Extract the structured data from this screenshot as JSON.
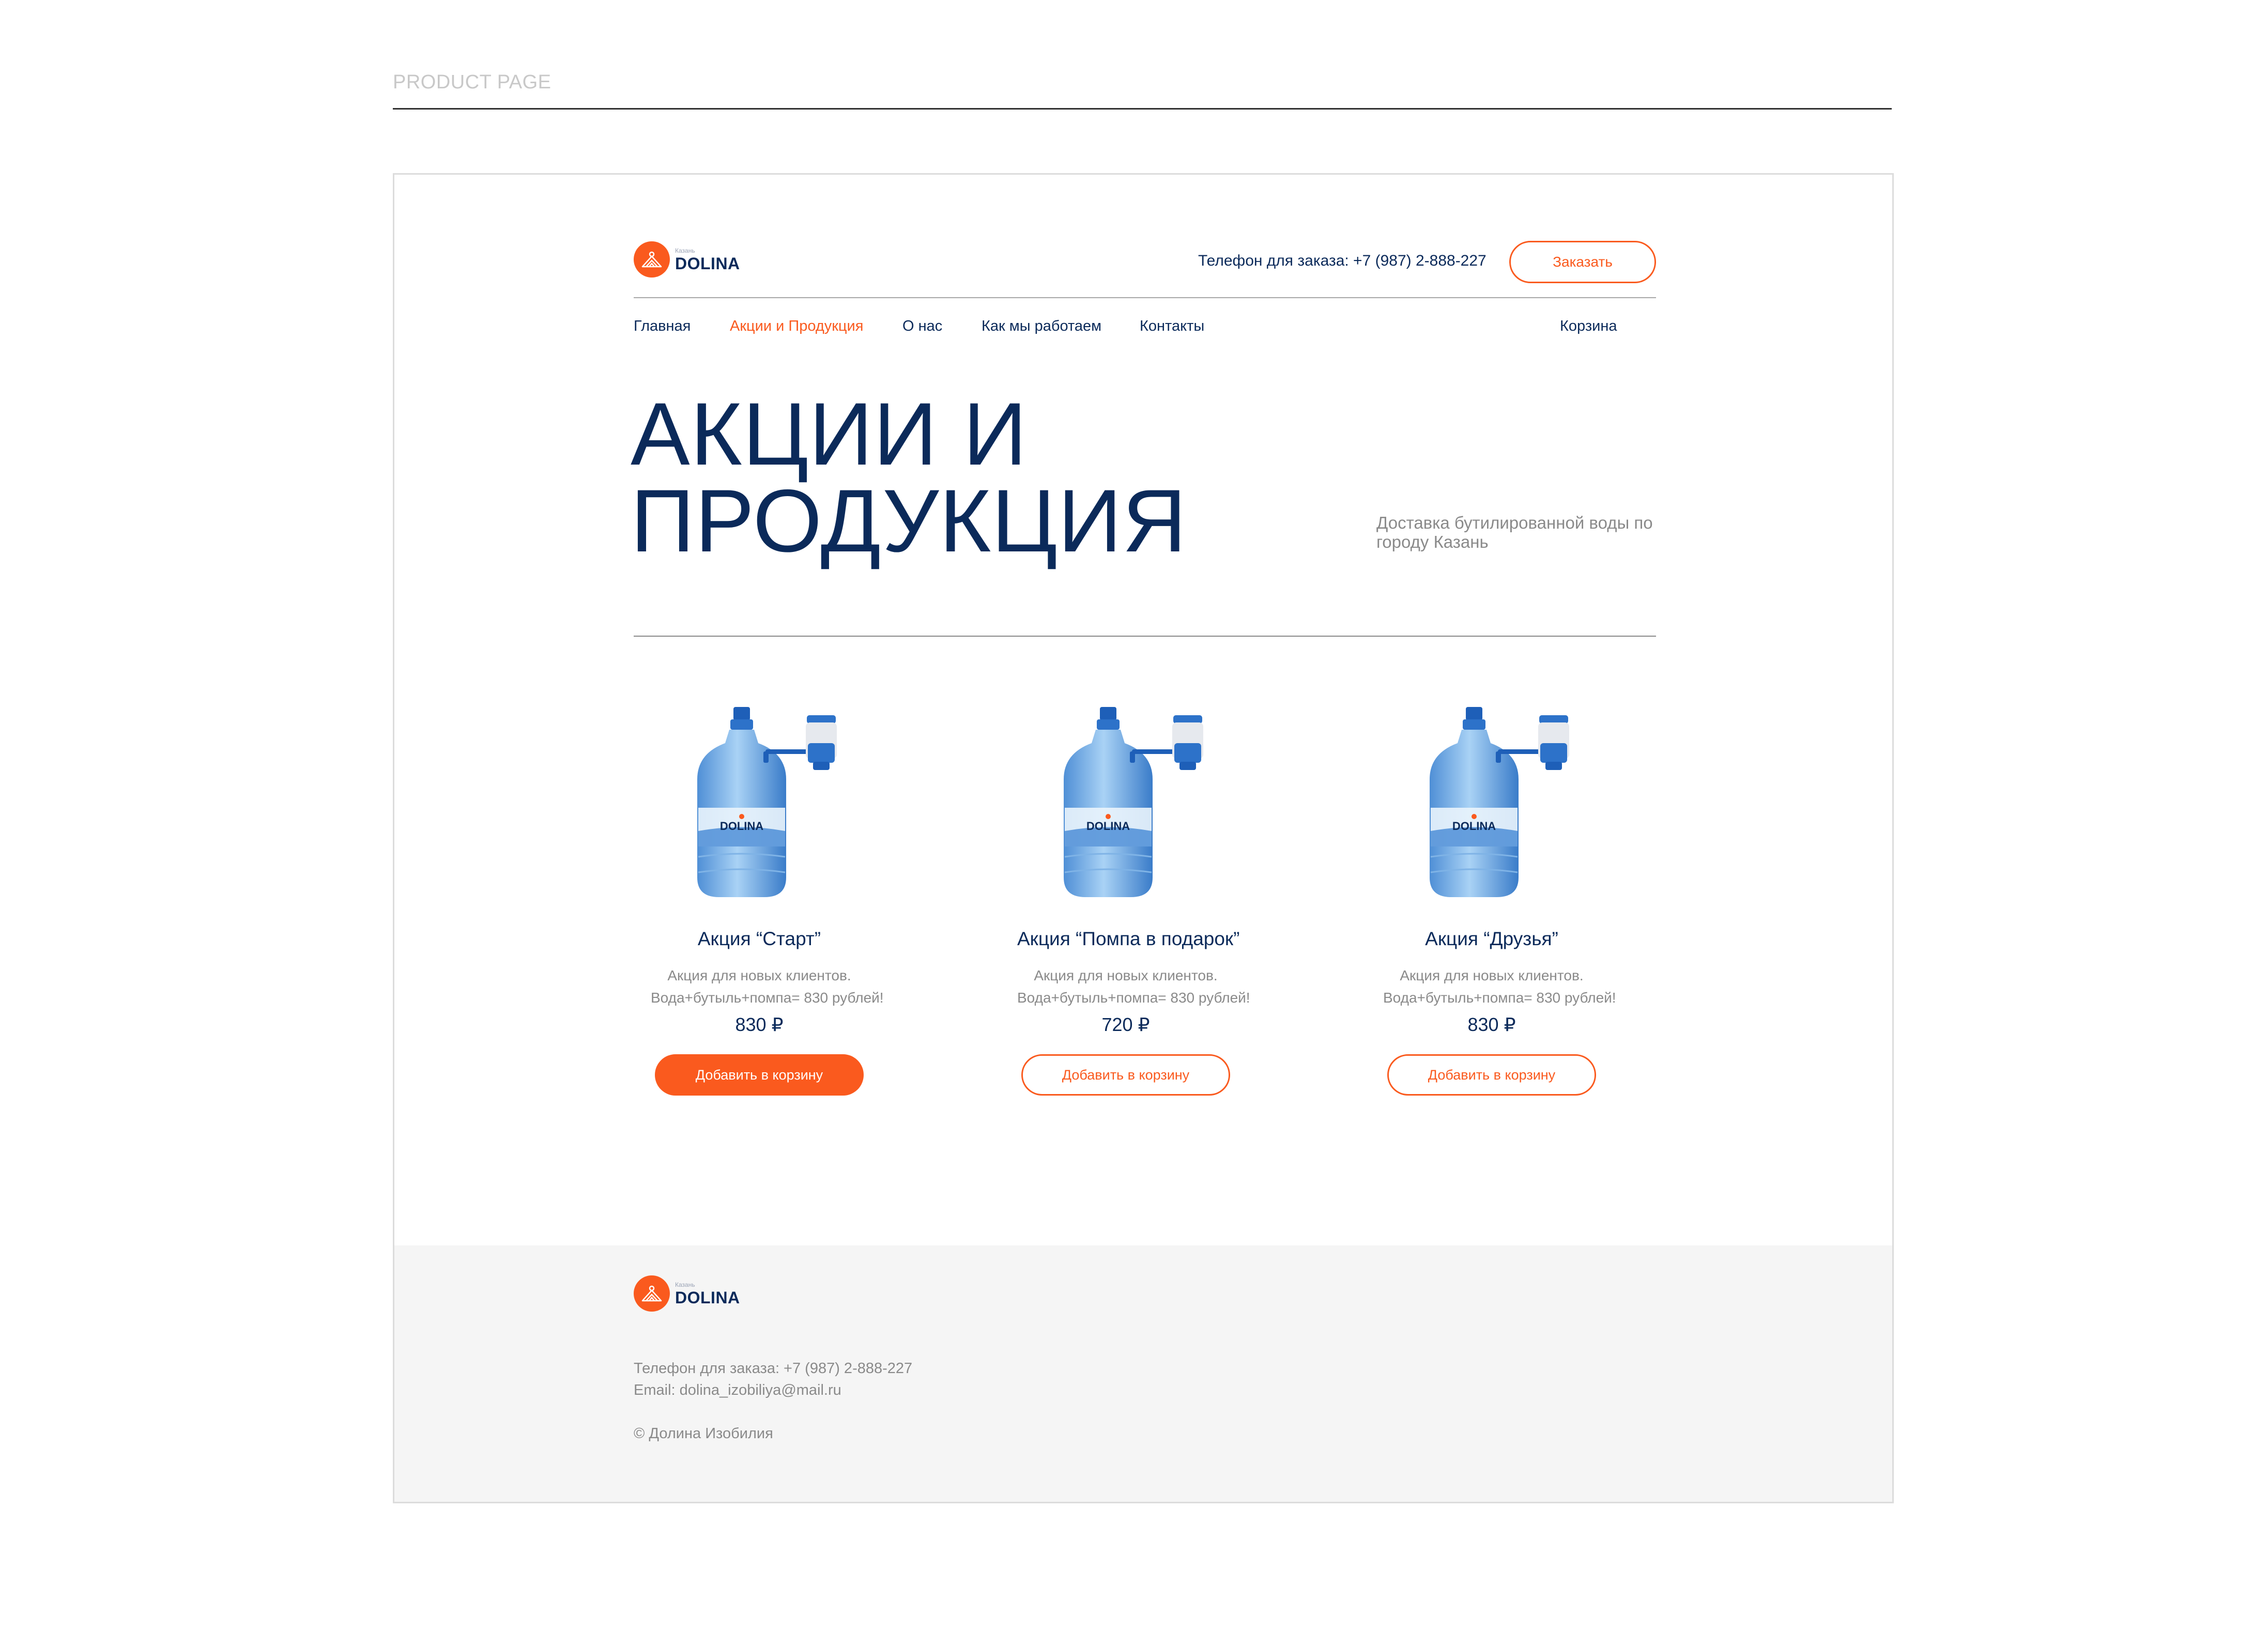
{
  "page_label": "PRODUCT PAGE",
  "brand": {
    "small": "Казань",
    "name": "DOLINA",
    "accent": "#fa5a1e",
    "navy": "#0b2a5a"
  },
  "header": {
    "phone": "Телефон для заказа: +7 (987) 2-888-227",
    "order_button": "Заказать"
  },
  "nav": {
    "items": [
      "Главная",
      "Акции и Продукция",
      "О нас",
      "Как мы работаем",
      "Контакты"
    ],
    "active_index": 1,
    "cart": "Корзина"
  },
  "hero": {
    "title_line1": "АКЦИИ И",
    "title_line2": "ПРОДУКЦИЯ",
    "subtitle": "Доставка бутилированной воды по городу Казань"
  },
  "products": [
    {
      "title": "Акция “Старт”",
      "desc1": "Акция для новых клиентов.",
      "desc2": "Вода+бутыль+помпа= 830 рублей!",
      "price": "830 ₽",
      "button": "Добавить в корзину",
      "bottle_label": "DOLINA"
    },
    {
      "title": "Акция “Помпа в подарок”",
      "desc1": "Акция для новых клиентов.",
      "desc2": "Вода+бутыль+помпа= 830 рублей!",
      "price": "720 ₽",
      "button": "Добавить в корзину",
      "bottle_label": "DOLINA"
    },
    {
      "title": "Акция “Друзья”",
      "desc1": "Акция для новых клиентов.",
      "desc2": "Вода+бутыль+помпа= 830 рублей!",
      "price": "830 ₽",
      "button": "Добавить в корзину",
      "bottle_label": "DOLINA"
    }
  ],
  "footer": {
    "phone": "Телефон для заказа: +7 (987) 2-888-227",
    "email": "Email: dolina_izobiliya@mail.ru",
    "copyright": "© Долина Изобилия"
  }
}
